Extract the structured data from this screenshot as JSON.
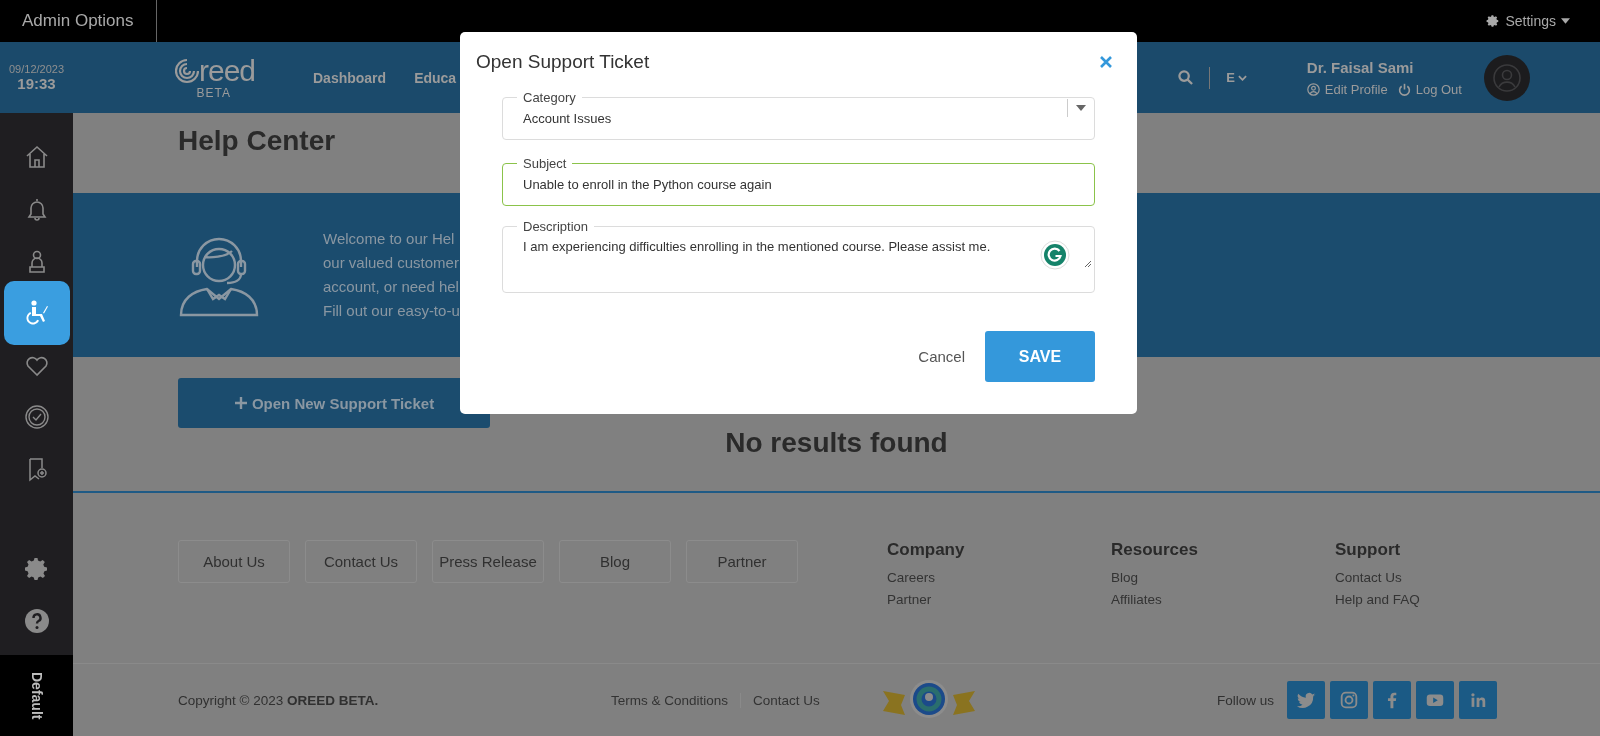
{
  "top_bar": {
    "title": "Admin Options",
    "settings": "Settings"
  },
  "header": {
    "date": "09/12/2023",
    "time": "19:33",
    "logo": "reed",
    "logo_sub": "BETA",
    "nav": [
      {
        "label": "Dashboard"
      },
      {
        "label": "Educa"
      }
    ],
    "language": "E",
    "user": {
      "name": "Dr. Faisal Sami",
      "edit_profile": "Edit Profile",
      "log_out": "Log Out"
    }
  },
  "sidebar": {
    "items": [
      {
        "selected": false
      },
      {
        "selected": false
      },
      {
        "selected": false
      },
      {
        "selected": true
      },
      {
        "selected": false
      },
      {
        "selected": false
      },
      {
        "selected": false
      }
    ],
    "bottom_items": [
      {
        "selected": false
      },
      {
        "selected": false
      }
    ],
    "theme": "Default"
  },
  "page": {
    "title": "Help Center",
    "banner_lines": [
      "Welcome to our Hel",
      "our valued customer",
      "account, or need hel",
      "Fill out our easy-to-u"
    ],
    "new_ticket_button": "Open New Support Ticket",
    "empty_message": "No results found"
  },
  "footer": {
    "buttons": [
      "About Us",
      "Contact Us",
      "Press Release",
      "Blog",
      "Partner"
    ],
    "columns": [
      {
        "heading": "Company",
        "links": [
          "Careers",
          "Partner"
        ]
      },
      {
        "heading": "Resources",
        "links": [
          "Blog",
          "Affiliates"
        ]
      },
      {
        "heading": "Support",
        "links": [
          "Contact Us",
          "Help and FAQ"
        ]
      }
    ],
    "copyright": "Copyright © 2023 **OREED BETA.**",
    "links": [
      "Terms & Conditions",
      "Contact Us"
    ],
    "follow_label": "Follow us"
  },
  "modal": {
    "title": "Open Support Ticket",
    "fields": [
      {
        "kind": "select",
        "label": "Category",
        "value": "Account Issues",
        "focused": false
      },
      {
        "kind": "text",
        "label": "Subject",
        "value": "Unable to enroll in the Python course again",
        "focused": true
      },
      {
        "kind": "textarea",
        "label": "Description",
        "value": "I am experiencing difficulties enrolling in the mentioned course. Please assist me.",
        "focused": false
      }
    ],
    "cancel": "Cancel",
    "save": "SAVE"
  }
}
